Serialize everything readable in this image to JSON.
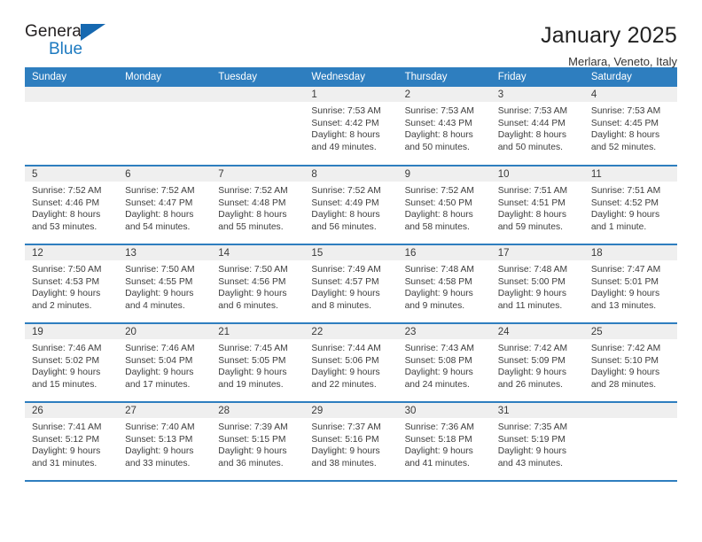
{
  "brand": {
    "name_line1": "General",
    "name_line2": "Blue",
    "logo_icon": "triangle-logo-icon",
    "accent_color": "#1c79c0"
  },
  "header": {
    "title": "January 2025",
    "subtitle": "Merlara, Veneto, Italy"
  },
  "theme": {
    "header_row_bg": "#2e7ebf",
    "daynum_bg": "#efefef",
    "text_color": "#3d3d3d"
  },
  "weekday_headers": [
    "Sunday",
    "Monday",
    "Tuesday",
    "Wednesday",
    "Thursday",
    "Friday",
    "Saturday"
  ],
  "labels": {
    "sunrise": "Sunrise:",
    "sunset": "Sunset:",
    "daylight": "Daylight:"
  },
  "weeks": [
    [
      {
        "day": "",
        "empty": true
      },
      {
        "day": "",
        "empty": true
      },
      {
        "day": "",
        "empty": true
      },
      {
        "day": "1",
        "sunrise": "Sunrise: 7:53 AM",
        "sunset": "Sunset: 4:42 PM",
        "daylight_line1": "Daylight: 8 hours",
        "daylight_line2": "and 49 minutes."
      },
      {
        "day": "2",
        "sunrise": "Sunrise: 7:53 AM",
        "sunset": "Sunset: 4:43 PM",
        "daylight_line1": "Daylight: 8 hours",
        "daylight_line2": "and 50 minutes."
      },
      {
        "day": "3",
        "sunrise": "Sunrise: 7:53 AM",
        "sunset": "Sunset: 4:44 PM",
        "daylight_line1": "Daylight: 8 hours",
        "daylight_line2": "and 50 minutes."
      },
      {
        "day": "4",
        "sunrise": "Sunrise: 7:53 AM",
        "sunset": "Sunset: 4:45 PM",
        "daylight_line1": "Daylight: 8 hours",
        "daylight_line2": "and 52 minutes."
      }
    ],
    [
      {
        "day": "5",
        "sunrise": "Sunrise: 7:52 AM",
        "sunset": "Sunset: 4:46 PM",
        "daylight_line1": "Daylight: 8 hours",
        "daylight_line2": "and 53 minutes."
      },
      {
        "day": "6",
        "sunrise": "Sunrise: 7:52 AM",
        "sunset": "Sunset: 4:47 PM",
        "daylight_line1": "Daylight: 8 hours",
        "daylight_line2": "and 54 minutes."
      },
      {
        "day": "7",
        "sunrise": "Sunrise: 7:52 AM",
        "sunset": "Sunset: 4:48 PM",
        "daylight_line1": "Daylight: 8 hours",
        "daylight_line2": "and 55 minutes."
      },
      {
        "day": "8",
        "sunrise": "Sunrise: 7:52 AM",
        "sunset": "Sunset: 4:49 PM",
        "daylight_line1": "Daylight: 8 hours",
        "daylight_line2": "and 56 minutes."
      },
      {
        "day": "9",
        "sunrise": "Sunrise: 7:52 AM",
        "sunset": "Sunset: 4:50 PM",
        "daylight_line1": "Daylight: 8 hours",
        "daylight_line2": "and 58 minutes."
      },
      {
        "day": "10",
        "sunrise": "Sunrise: 7:51 AM",
        "sunset": "Sunset: 4:51 PM",
        "daylight_line1": "Daylight: 8 hours",
        "daylight_line2": "and 59 minutes."
      },
      {
        "day": "11",
        "sunrise": "Sunrise: 7:51 AM",
        "sunset": "Sunset: 4:52 PM",
        "daylight_line1": "Daylight: 9 hours",
        "daylight_line2": "and 1 minute."
      }
    ],
    [
      {
        "day": "12",
        "sunrise": "Sunrise: 7:50 AM",
        "sunset": "Sunset: 4:53 PM",
        "daylight_line1": "Daylight: 9 hours",
        "daylight_line2": "and 2 minutes."
      },
      {
        "day": "13",
        "sunrise": "Sunrise: 7:50 AM",
        "sunset": "Sunset: 4:55 PM",
        "daylight_line1": "Daylight: 9 hours",
        "daylight_line2": "and 4 minutes."
      },
      {
        "day": "14",
        "sunrise": "Sunrise: 7:50 AM",
        "sunset": "Sunset: 4:56 PM",
        "daylight_line1": "Daylight: 9 hours",
        "daylight_line2": "and 6 minutes."
      },
      {
        "day": "15",
        "sunrise": "Sunrise: 7:49 AM",
        "sunset": "Sunset: 4:57 PM",
        "daylight_line1": "Daylight: 9 hours",
        "daylight_line2": "and 8 minutes."
      },
      {
        "day": "16",
        "sunrise": "Sunrise: 7:48 AM",
        "sunset": "Sunset: 4:58 PM",
        "daylight_line1": "Daylight: 9 hours",
        "daylight_line2": "and 9 minutes."
      },
      {
        "day": "17",
        "sunrise": "Sunrise: 7:48 AM",
        "sunset": "Sunset: 5:00 PM",
        "daylight_line1": "Daylight: 9 hours",
        "daylight_line2": "and 11 minutes."
      },
      {
        "day": "18",
        "sunrise": "Sunrise: 7:47 AM",
        "sunset": "Sunset: 5:01 PM",
        "daylight_line1": "Daylight: 9 hours",
        "daylight_line2": "and 13 minutes."
      }
    ],
    [
      {
        "day": "19",
        "sunrise": "Sunrise: 7:46 AM",
        "sunset": "Sunset: 5:02 PM",
        "daylight_line1": "Daylight: 9 hours",
        "daylight_line2": "and 15 minutes."
      },
      {
        "day": "20",
        "sunrise": "Sunrise: 7:46 AM",
        "sunset": "Sunset: 5:04 PM",
        "daylight_line1": "Daylight: 9 hours",
        "daylight_line2": "and 17 minutes."
      },
      {
        "day": "21",
        "sunrise": "Sunrise: 7:45 AM",
        "sunset": "Sunset: 5:05 PM",
        "daylight_line1": "Daylight: 9 hours",
        "daylight_line2": "and 19 minutes."
      },
      {
        "day": "22",
        "sunrise": "Sunrise: 7:44 AM",
        "sunset": "Sunset: 5:06 PM",
        "daylight_line1": "Daylight: 9 hours",
        "daylight_line2": "and 22 minutes."
      },
      {
        "day": "23",
        "sunrise": "Sunrise: 7:43 AM",
        "sunset": "Sunset: 5:08 PM",
        "daylight_line1": "Daylight: 9 hours",
        "daylight_line2": "and 24 minutes."
      },
      {
        "day": "24",
        "sunrise": "Sunrise: 7:42 AM",
        "sunset": "Sunset: 5:09 PM",
        "daylight_line1": "Daylight: 9 hours",
        "daylight_line2": "and 26 minutes."
      },
      {
        "day": "25",
        "sunrise": "Sunrise: 7:42 AM",
        "sunset": "Sunset: 5:10 PM",
        "daylight_line1": "Daylight: 9 hours",
        "daylight_line2": "and 28 minutes."
      }
    ],
    [
      {
        "day": "26",
        "sunrise": "Sunrise: 7:41 AM",
        "sunset": "Sunset: 5:12 PM",
        "daylight_line1": "Daylight: 9 hours",
        "daylight_line2": "and 31 minutes."
      },
      {
        "day": "27",
        "sunrise": "Sunrise: 7:40 AM",
        "sunset": "Sunset: 5:13 PM",
        "daylight_line1": "Daylight: 9 hours",
        "daylight_line2": "and 33 minutes."
      },
      {
        "day": "28",
        "sunrise": "Sunrise: 7:39 AM",
        "sunset": "Sunset: 5:15 PM",
        "daylight_line1": "Daylight: 9 hours",
        "daylight_line2": "and 36 minutes."
      },
      {
        "day": "29",
        "sunrise": "Sunrise: 7:37 AM",
        "sunset": "Sunset: 5:16 PM",
        "daylight_line1": "Daylight: 9 hours",
        "daylight_line2": "and 38 minutes."
      },
      {
        "day": "30",
        "sunrise": "Sunrise: 7:36 AM",
        "sunset": "Sunset: 5:18 PM",
        "daylight_line1": "Daylight: 9 hours",
        "daylight_line2": "and 41 minutes."
      },
      {
        "day": "31",
        "sunrise": "Sunrise: 7:35 AM",
        "sunset": "Sunset: 5:19 PM",
        "daylight_line1": "Daylight: 9 hours",
        "daylight_line2": "and 43 minutes."
      },
      {
        "day": "",
        "empty": true
      }
    ]
  ]
}
